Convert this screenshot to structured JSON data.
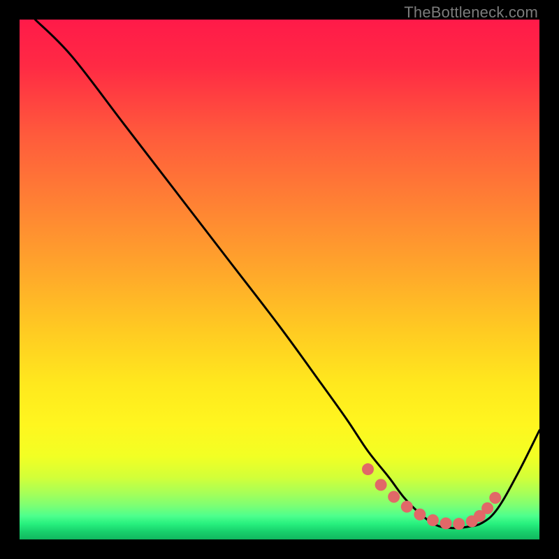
{
  "watermark": "TheBottleneck.com",
  "chart_data": {
    "type": "line",
    "title": "",
    "xlabel": "",
    "ylabel": "",
    "xlim": [
      0,
      100
    ],
    "ylim": [
      0,
      100
    ],
    "grid": false,
    "series": [
      {
        "name": "bottleneck-curve",
        "color": "#000000",
        "x": [
          3,
          10,
          20,
          30,
          40,
          50,
          58,
          63,
          67,
          71,
          74,
          77,
          80,
          83,
          86,
          89,
          92,
          96,
          100
        ],
        "y": [
          100,
          93,
          80,
          67,
          54,
          41,
          30,
          23,
          17,
          12,
          8,
          5,
          2.8,
          2.2,
          2.4,
          3.2,
          6,
          13,
          21
        ]
      }
    ],
    "highlight_band": {
      "name": "optimal-zone",
      "color": "#e16868",
      "x": [
        67,
        69.5,
        72,
        74.5,
        77,
        79.5,
        82,
        84.5,
        87,
        88.5,
        90,
        91.5
      ],
      "y": [
        13.5,
        10.5,
        8.2,
        6.3,
        4.8,
        3.7,
        3.1,
        3.0,
        3.5,
        4.5,
        6.0,
        8.0
      ]
    },
    "background_gradient": {
      "stops": [
        {
          "offset": 0.0,
          "color": "#ff1a49"
        },
        {
          "offset": 0.09,
          "color": "#ff2a44"
        },
        {
          "offset": 0.22,
          "color": "#ff5a3c"
        },
        {
          "offset": 0.35,
          "color": "#ff8034"
        },
        {
          "offset": 0.48,
          "color": "#ffa62b"
        },
        {
          "offset": 0.6,
          "color": "#ffcb22"
        },
        {
          "offset": 0.7,
          "color": "#ffe81e"
        },
        {
          "offset": 0.78,
          "color": "#fff61f"
        },
        {
          "offset": 0.84,
          "color": "#f2ff24"
        },
        {
          "offset": 0.88,
          "color": "#d3ff38"
        },
        {
          "offset": 0.91,
          "color": "#a8ff57"
        },
        {
          "offset": 0.935,
          "color": "#7cff74"
        },
        {
          "offset": 0.955,
          "color": "#4dff8d"
        },
        {
          "offset": 0.97,
          "color": "#27f07e"
        },
        {
          "offset": 0.985,
          "color": "#18d06c"
        },
        {
          "offset": 1.0,
          "color": "#11b75f"
        }
      ]
    }
  }
}
